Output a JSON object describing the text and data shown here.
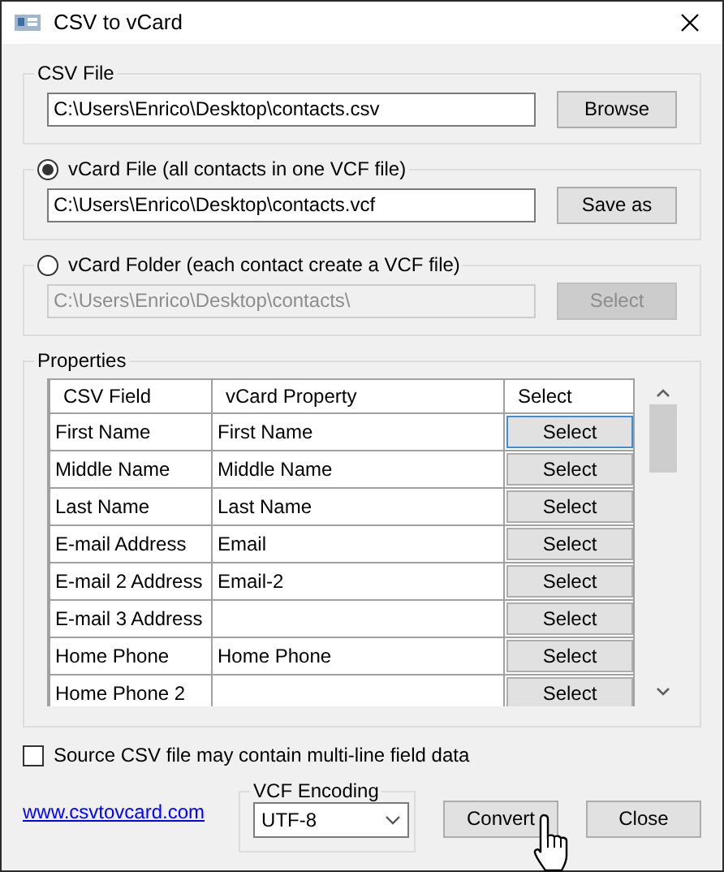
{
  "window": {
    "title": "CSV to vCard"
  },
  "csv_file": {
    "label": "CSV File",
    "value": "C:\\Users\\Enrico\\Desktop\\contacts.csv",
    "button": "Browse"
  },
  "outputs": [
    {
      "label": "vCard File (all contacts in one VCF file)",
      "selected": true,
      "disabled": false,
      "value": "C:\\Users\\Enrico\\Desktop\\contacts.vcf",
      "button": "Save as"
    },
    {
      "label": "vCard Folder (each contact create a VCF file)",
      "selected": false,
      "disabled": true,
      "value": "C:\\Users\\Enrico\\Desktop\\contacts\\",
      "button": "Select"
    }
  ],
  "properties": {
    "label": "Properties",
    "columns": [
      "CSV Field",
      "vCard Property",
      "Select"
    ],
    "rows": [
      {
        "csv_field": "First Name",
        "vcard_property": "First Name",
        "button": "Select",
        "focused": true
      },
      {
        "csv_field": "Middle Name",
        "vcard_property": "Middle Name",
        "button": "Select",
        "focused": false
      },
      {
        "csv_field": "Last Name",
        "vcard_property": "Last Name",
        "button": "Select",
        "focused": false
      },
      {
        "csv_field": "E-mail Address",
        "vcard_property": "Email",
        "button": "Select",
        "focused": false
      },
      {
        "csv_field": "E-mail 2 Address",
        "vcard_property": "Email-2",
        "button": "Select",
        "focused": false
      },
      {
        "csv_field": "E-mail 3 Address",
        "vcard_property": "",
        "button": "Select",
        "focused": false
      },
      {
        "csv_field": "Home Phone",
        "vcard_property": "Home Phone",
        "button": "Select",
        "focused": false
      },
      {
        "csv_field": "Home Phone 2",
        "vcard_property": "",
        "button": "Select",
        "focused": false
      }
    ]
  },
  "multiline": {
    "label": "Source CSV file may contain multi-line field data",
    "checked": false
  },
  "link": "www.csvtovcard.com",
  "encoding": {
    "label": "VCF Encoding",
    "value": "UTF-8"
  },
  "buttons": [
    "Convert",
    "Close"
  ]
}
